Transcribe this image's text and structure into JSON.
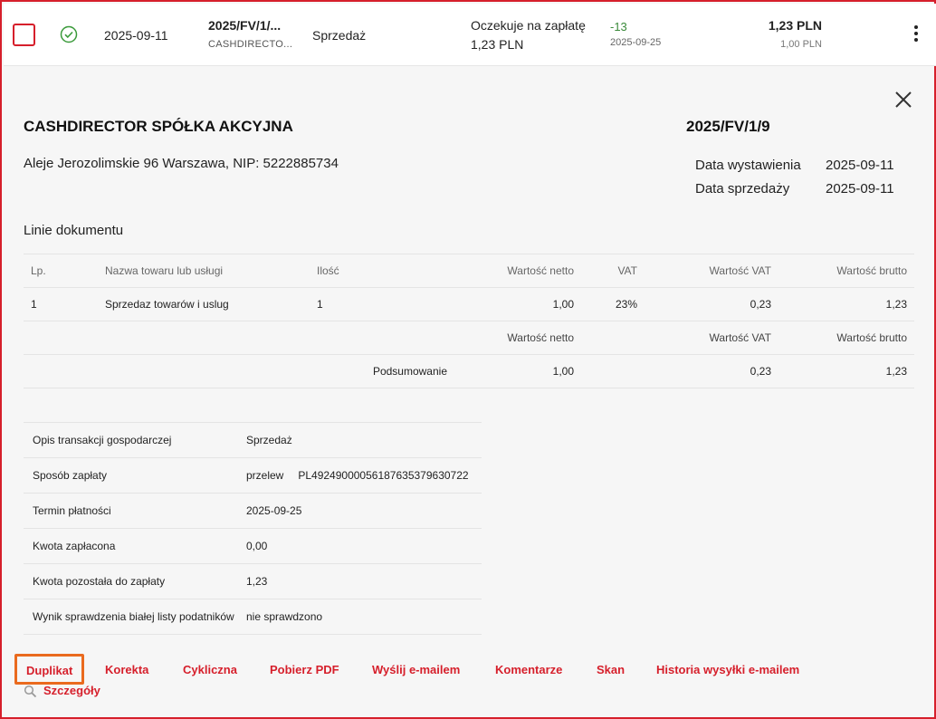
{
  "row": {
    "issue_date": "2025-09-11",
    "doc_number": "2025/FV/1/...",
    "contractor": "CASHDIRECTO...",
    "doc_type": "Sprzedaż",
    "payment_status": "Oczekuje na zapłatę",
    "payment_amount": "1,23 PLN",
    "days_to_due": "-13",
    "due_date": "2025-09-25",
    "gross": "1,23 PLN",
    "net": "1,00 PLN",
    "status_icon": "check-circle-icon",
    "status_color": "#3a9a3a"
  },
  "invoice": {
    "seller_name": "CASHDIRECTOR SPÓŁKA AKCYJNA",
    "seller_address": "Aleje Jerozolimskie 96 Warszawa, NIP: 5222885734",
    "number": "2025/FV/1/9",
    "issue_date_label": "Data wystawienia",
    "issue_date": "2025-09-11",
    "sale_date_label": "Data sprzedaży",
    "sale_date": "2025-09-11"
  },
  "lines": {
    "title": "Linie dokumentu",
    "headers": {
      "lp": "Lp.",
      "name": "Nazwa towaru lub usługi",
      "qty": "Ilość",
      "net": "Wartość netto",
      "vat": "VAT",
      "vat_value": "Wartość VAT",
      "gross": "Wartość brutto"
    },
    "items": [
      {
        "lp": "1",
        "name": "Sprzedaz towarów i uslug",
        "qty": "1",
        "net": "1,00",
        "vat": "23%",
        "vat_value": "0,23",
        "gross": "1,23"
      }
    ],
    "summary_headers": {
      "net": "Wartość netto",
      "vat_value": "Wartość VAT",
      "gross": "Wartość brutto"
    },
    "summary": {
      "label": "Podsumowanie",
      "net": "1,00",
      "vat_value": "0,23",
      "gross": "1,23"
    }
  },
  "details": {
    "transaction_label": "Opis transakcji gospodarczej",
    "transaction_value": "Sprzedaż",
    "payment_method_label": "Sposób zapłaty",
    "payment_method_value": "przelew",
    "account": "PL49249000056187635379630722",
    "due_label": "Termin płatności",
    "due_value": "2025-09-25",
    "paid_label": "Kwota zapłacona",
    "paid_value": "0,00",
    "remaining_label": "Kwota pozostała do zapłaty",
    "remaining_value": "1,23",
    "whitelist_label": "Wynik sprawdzenia białej listy podatników",
    "whitelist_value": "nie sprawdzono"
  },
  "actions": {
    "duplicate": "Duplikat",
    "correction": "Korekta",
    "cyclic": "Cykliczna",
    "pdf": "Pobierz PDF",
    "email": "Wyślij e-mailem",
    "comments": "Komentarze",
    "scan": "Skan",
    "email_history": "Historia wysyłki e-mailem",
    "details": "Szczegóły"
  },
  "colors": {
    "accent": "#d61f2b",
    "highlight": "#ea6a1e"
  }
}
